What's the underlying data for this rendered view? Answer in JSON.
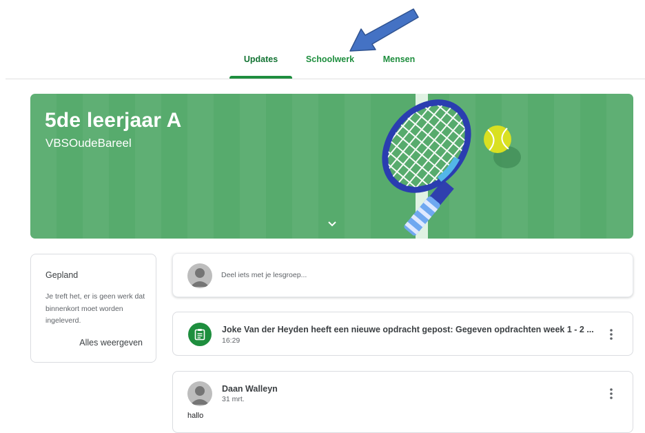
{
  "tabs": [
    {
      "label": "Updates",
      "active": true
    },
    {
      "label": "Schoolwerk",
      "active": false
    },
    {
      "label": "Mensen",
      "active": false
    }
  ],
  "banner": {
    "title": "5de leerjaar A",
    "subtitle": "VBSOudeBareel",
    "theme_color": "#57ab6d",
    "expand_icon": "chevron-down-icon"
  },
  "upcoming": {
    "title": "Gepland",
    "text": "Je treft het, er is geen werk dat binnenkort moet worden ingeleverd.",
    "link_label": "Alles weergeven"
  },
  "share": {
    "placeholder": "Deel iets met je lesgroep..."
  },
  "stream": [
    {
      "type": "assignment",
      "title": "Joke Van der Heyden heeft een nieuwe opdracht gepost: Gegeven opdrachten week 1 - 2 ...",
      "time": "16:29",
      "icon": "assignment-icon"
    },
    {
      "type": "announcement",
      "author": "Daan Walleyn",
      "date": "31 mrt.",
      "text": "hallo"
    }
  ],
  "colors": {
    "accent": "#1e8e3e",
    "banner": "#57ab6d",
    "annotation_arrow": "#4472c4"
  }
}
